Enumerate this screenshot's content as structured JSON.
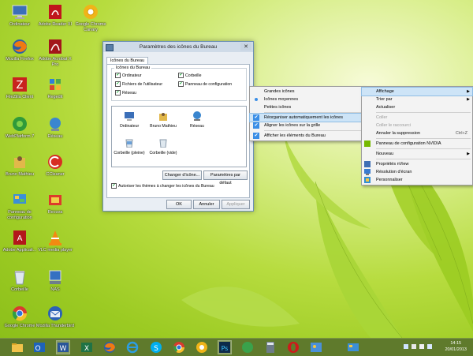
{
  "desktop_icons": [
    {
      "id": "ordinateur",
      "label": "Ordinateur",
      "icon": "computer-icon"
    },
    {
      "id": "adobe-reader",
      "label": "Adobe Reader XI",
      "icon": "adobe-reader-icon"
    },
    {
      "id": "chrome-canary",
      "label": "Google Chrome Canary",
      "icon": "chrome-canary-icon"
    },
    {
      "id": "firefox",
      "label": "Mozilla Firefox",
      "icon": "firefox-icon"
    },
    {
      "id": "acrobat-pro",
      "label": "Adobe Acrobat X Pro",
      "icon": "acrobat-icon"
    },
    {
      "id": "filezilla",
      "label": "FileZilla Client",
      "icon": "filezilla-icon"
    },
    {
      "id": "regedit",
      "label": "Regedit",
      "icon": "regedit-icon"
    },
    {
      "id": "webplatform",
      "label": "WebPlatform 7",
      "icon": "webplatform-icon"
    },
    {
      "id": "reseau",
      "label": "Réseau",
      "icon": "network-icon"
    },
    {
      "id": "bruno",
      "label": "Bruno Mathieu",
      "icon": "user-folder-icon"
    },
    {
      "id": "ccleaner",
      "label": "CCleaner",
      "icon": "ccleaner-icon"
    },
    {
      "id": "panneau",
      "label": "Panneau de configuration",
      "icon": "control-panel-icon"
    },
    {
      "id": "recuva",
      "label": "Recuva",
      "icon": "recuva-icon"
    },
    {
      "id": "adobe-app",
      "label": "Adobe Applicati...",
      "icon": "adobe-app-icon"
    },
    {
      "id": "vlc",
      "label": "VLC media player",
      "icon": "vlc-icon"
    },
    {
      "id": "corbeille",
      "label": "Corbeille",
      "icon": "recycle-bin-icon"
    },
    {
      "id": "nas",
      "label": "NAS",
      "icon": "nas-icon"
    },
    {
      "id": "google-chrome",
      "label": "Google Chrome",
      "icon": "chrome-icon"
    },
    {
      "id": "thunderbird",
      "label": "Mozilla Thunderbird",
      "icon": "thunderbird-icon"
    }
  ],
  "dialog": {
    "title": "Paramètres des icônes du Bureau",
    "tab": "Icônes du Bureau",
    "group_label": "Icônes du Bureau",
    "checkboxes": [
      {
        "label": "Ordinateur",
        "checked": true
      },
      {
        "label": "Fichiers de l'utilisateur",
        "checked": true
      },
      {
        "label": "Réseau",
        "checked": true
      },
      {
        "label": "Corbeille",
        "checked": true
      },
      {
        "label": "Panneau de configuration",
        "checked": true
      }
    ],
    "icon_items": [
      "Ordinateur",
      "Bruno Mathieu",
      "Réseau",
      "Corbeille (pleine)",
      "Corbeille (vide)"
    ],
    "change_icon": "Changer d'icône...",
    "default": "Paramètres par défaut",
    "themes_checkbox": "Autoriser les thèmes à changer les icônes du Bureau",
    "ok": "OK",
    "cancel": "Annuler",
    "apply": "Appliquer",
    "close_glyph": "✕"
  },
  "submenu": {
    "items": [
      {
        "label": "Grandes icônes",
        "mark": "none"
      },
      {
        "label": "Icônes moyennes",
        "mark": "dot"
      },
      {
        "label": "Petites icônes",
        "mark": "none"
      },
      {
        "label": "Réorganiser automatiquement les icônes",
        "mark": "check",
        "highlight": true
      },
      {
        "label": "Aligner les icônes sur la grille",
        "mark": "check"
      },
      {
        "label": "Afficher les éléments du Bureau",
        "mark": "check"
      }
    ]
  },
  "context_menu": {
    "affichage": "Affichage",
    "trier": "Trier par",
    "actualiser": "Actualiser",
    "coller": "Coller",
    "coller_raccourci": "Coller le raccourci",
    "annuler": "Annuler la suppression",
    "annuler_shortcut": "Ctrl+Z",
    "nvidia": "Panneau de configuration NVIDIA",
    "nouveau": "Nouveau",
    "nview": "Propriétés nView",
    "resolution": "Résolution d'écran",
    "personnaliser": "Personnaliser"
  },
  "taskbar": {
    "apps": [
      "explorer-icon",
      "outlook-icon",
      "word-icon",
      "excel-icon",
      "firefox-icon",
      "ie-icon",
      "skype-icon",
      "chrome-icon",
      "chrome-canary-icon",
      "photoshop-icon",
      "lync-icon",
      "calculator-icon",
      "opera-icon",
      "paint-icon",
      "control-panel-icon"
    ],
    "time": "14:15",
    "date": "20/01/2013"
  },
  "colors": {
    "taskbar": "#5f7a2c",
    "highlight": "#cde4f7",
    "accent": "#3a8ee6"
  }
}
